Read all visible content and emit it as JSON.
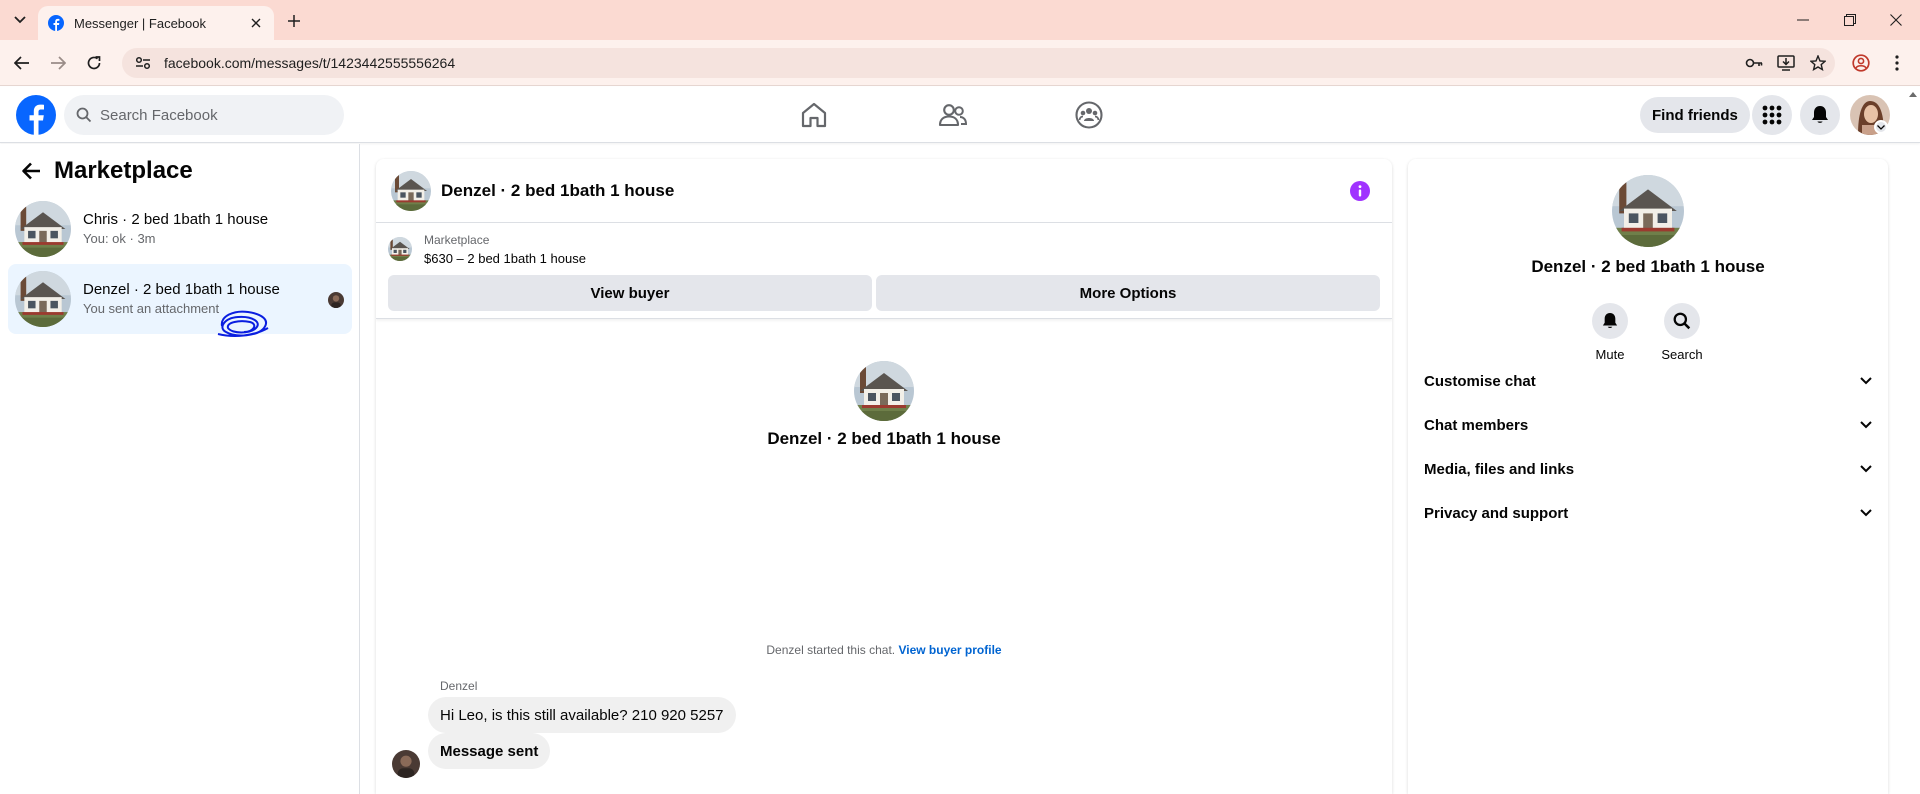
{
  "browser": {
    "tab_title": "Messenger | Facebook",
    "url": "facebook.com/messages/t/1423442555556264"
  },
  "fbnav": {
    "search_placeholder": "Search Facebook",
    "find_friends": "Find friends"
  },
  "sidebar": {
    "title": "Marketplace",
    "conversations": [
      {
        "name": "Chris · 2 bed 1bath 1 house",
        "preview": "You: ok · 3m"
      },
      {
        "name": "Denzel · 2 bed 1bath 1 house",
        "preview": "You sent an attachment"
      }
    ]
  },
  "chat": {
    "title": "Denzel · 2 bed 1bath 1 house",
    "listing_label": "Marketplace",
    "listing_price": "$630 – 2 bed 1bath 1 house",
    "view_buyer": "View buyer",
    "more_options": "More Options",
    "intro_title": "Denzel · 2 bed 1bath 1 house",
    "started_text": "Denzel started this chat.",
    "started_link": "View buyer profile",
    "sender": "Denzel",
    "messages": [
      {
        "text": "Hi Leo, is this still available? 210 920 5257"
      },
      {
        "text": "Message sent"
      }
    ]
  },
  "rpanel": {
    "title": "Denzel · 2 bed 1bath 1 house",
    "actions": [
      {
        "label": "Mute",
        "icon": "bell-icon"
      },
      {
        "label": "Search",
        "icon": "search-icon"
      }
    ],
    "sections": [
      {
        "label": "Customise chat"
      },
      {
        "label": "Chat members"
      },
      {
        "label": "Media, files and links"
      },
      {
        "label": "Privacy and support"
      }
    ]
  },
  "colors": {
    "fb_blue": "#0866ff",
    "tabbar": "#fbdad2",
    "active_conv": "#ebf5ff",
    "info_purple": "#a033ff",
    "link_blue": "#0064d1",
    "scribble": "#0a1ee0"
  }
}
